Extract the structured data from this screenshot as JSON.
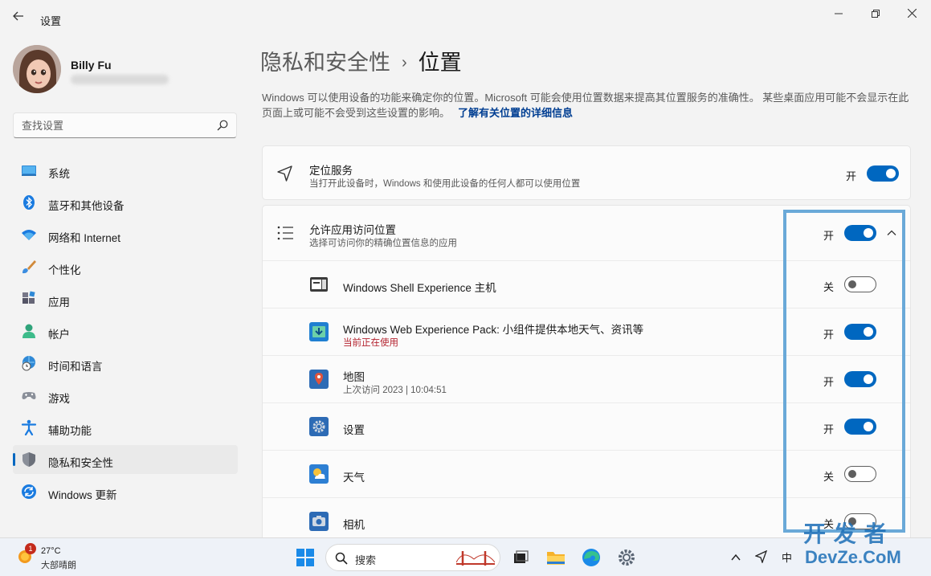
{
  "window": {
    "title": "设置",
    "back_icon": "arrow-left-icon",
    "controls": [
      "minimize-icon",
      "maximize-icon",
      "close-icon"
    ]
  },
  "profile": {
    "name": "Billy Fu"
  },
  "search": {
    "placeholder": "查找设置"
  },
  "sidebar": {
    "items": [
      {
        "label": "系统",
        "icon": "system-icon"
      },
      {
        "label": "蓝牙和其他设备",
        "icon": "bluetooth-icon"
      },
      {
        "label": "网络和 Internet",
        "icon": "wifi-icon"
      },
      {
        "label": "个性化",
        "icon": "brush-icon"
      },
      {
        "label": "应用",
        "icon": "apps-icon"
      },
      {
        "label": "帐户",
        "icon": "account-icon"
      },
      {
        "label": "时间和语言",
        "icon": "globe-clock-icon"
      },
      {
        "label": "游戏",
        "icon": "gamepad-icon"
      },
      {
        "label": "辅助功能",
        "icon": "accessibility-icon"
      },
      {
        "label": "隐私和安全性",
        "icon": "shield-icon",
        "active": true
      },
      {
        "label": "Windows 更新",
        "icon": "update-icon"
      }
    ]
  },
  "breadcrumb": {
    "parent": "隐私和安全性",
    "separator": "›",
    "current": "位置"
  },
  "description": {
    "text": "Windows 可以使用设备的功能来确定你的位置。Microsoft 可能会使用位置数据来提高其位置服务的准确性。 某些桌面应用可能不会显示在此页面上或可能不会受到这些设置的影响。",
    "link": "了解有关位置的详细信息"
  },
  "location_service": {
    "title": "定位服务",
    "subtitle": "当打开此设备时，Windows 和使用此设备的任何人都可以使用位置",
    "state": "开",
    "on": true
  },
  "app_access": {
    "title": "允许应用访问位置",
    "subtitle": "选择可访问你的精确位置信息的应用",
    "state": "开",
    "on": true,
    "apps": [
      {
        "name": "Windows Shell Experience 主机",
        "sub": "",
        "state": "关",
        "on": false,
        "icon": "shell-experience-icon"
      },
      {
        "name": "Windows Web Experience Pack: 小组件提供本地天气、资讯等",
        "sub": "当前正在使用",
        "sub_active": true,
        "state": "开",
        "on": true,
        "icon": "web-experience-icon"
      },
      {
        "name": "地图",
        "sub": "上次访问 2023  |  10:04:51",
        "state": "开",
        "on": true,
        "icon": "maps-icon"
      },
      {
        "name": "设置",
        "sub": "",
        "state": "开",
        "on": true,
        "icon": "settings-icon"
      },
      {
        "name": "天气",
        "sub": "",
        "state": "关",
        "on": false,
        "icon": "weather-app-icon"
      },
      {
        "name": "相机",
        "sub": "",
        "state": "关",
        "on": false,
        "icon": "camera-icon"
      }
    ]
  },
  "taskbar": {
    "weather_temp": "27°C",
    "weather_desc": "大部晴朗",
    "weather_badge": "1",
    "search_label": "搜索",
    "ime": "中"
  },
  "watermark": {
    "line1": "开 发 者",
    "line2": "DevZe.CoM"
  },
  "colors": {
    "accent": "#0067c0",
    "highlight_box": "#6aa9d8",
    "active_use": "#b4232f"
  }
}
